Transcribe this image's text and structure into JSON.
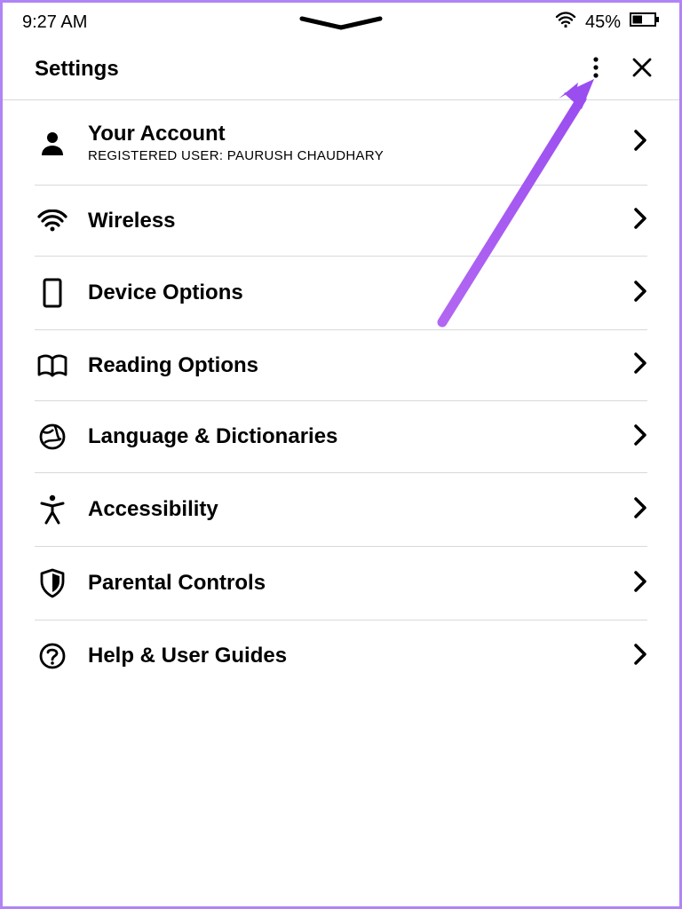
{
  "status": {
    "time": "9:27 AM",
    "battery_percent": "45%"
  },
  "header": {
    "title": "Settings"
  },
  "rows": {
    "account": {
      "title": "Your Account",
      "subtitle": "REGISTERED USER: PAURUSH CHAUDHARY"
    },
    "wireless": {
      "title": "Wireless"
    },
    "device": {
      "title": "Device Options"
    },
    "reading": {
      "title": "Reading Options"
    },
    "language": {
      "title": "Language & Dictionaries"
    },
    "accessibility": {
      "title": "Accessibility"
    },
    "parental": {
      "title": "Parental Controls"
    },
    "help": {
      "title": "Help & User Guides"
    }
  }
}
